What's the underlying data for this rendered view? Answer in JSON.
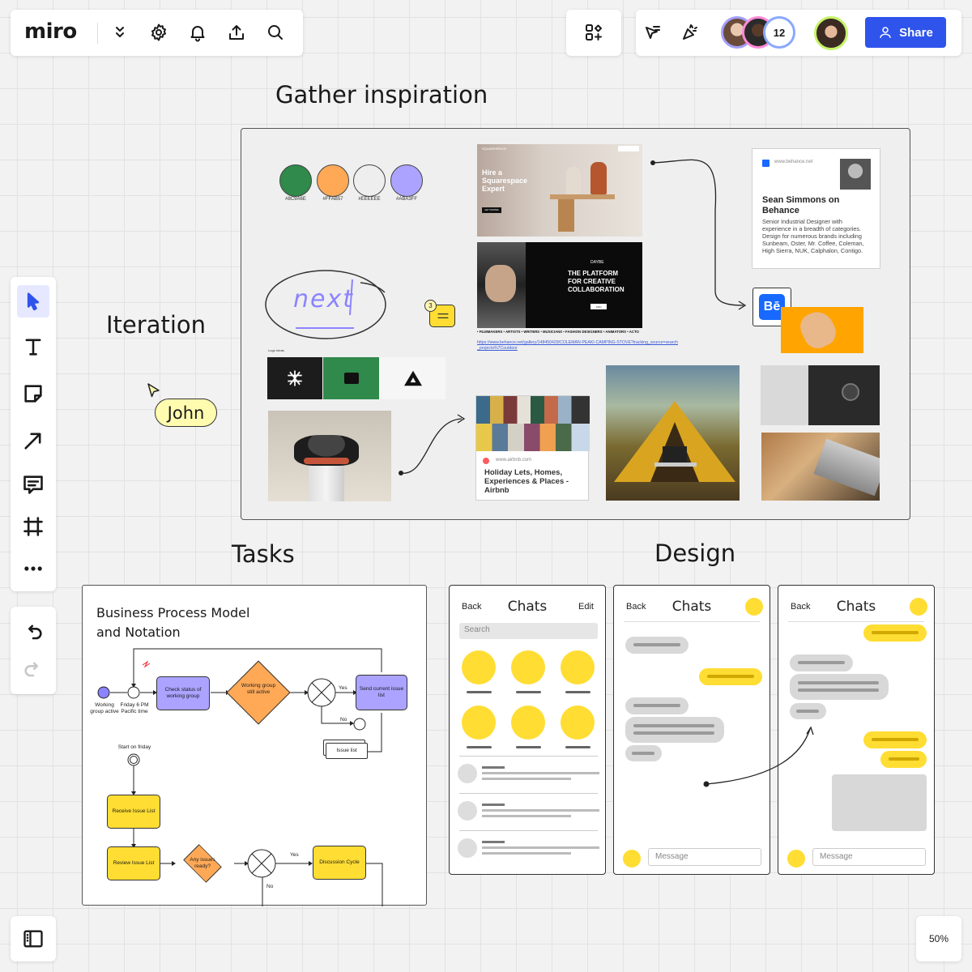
{
  "app": {
    "logo": "miro",
    "zoom": "50%"
  },
  "top_toolbar": {
    "icons": [
      "chevron-double-down-icon",
      "gear-icon",
      "bell-icon",
      "upload-icon",
      "search-icon"
    ]
  },
  "collab": {
    "user_count": "12",
    "share_label": "Share",
    "accent": "#2f54eb"
  },
  "sections": {
    "gather": "Gather inspiration",
    "iteration": "Iteration",
    "tasks": "Tasks",
    "design": "Design"
  },
  "cursor": {
    "name": "John"
  },
  "swatches": [
    {
      "color": "#2F8A4B",
      "label": "#8C9A6E"
    },
    {
      "color": "#FFA957",
      "label": "#FFAB57"
    },
    {
      "color": "#EEEEEE",
      "label": "#EEEEEE"
    },
    {
      "color": "#ABA3FF",
      "label": "#ABA3FF"
    }
  ],
  "sketch_word": "next",
  "comment_count": "3",
  "logo_strip_label": "Logo Ideas",
  "squarespace": {
    "brand": "SQUARESPACE",
    "headline_1": "Hire a",
    "headline_2": "Squarespace",
    "headline_3": "Expert",
    "btn": "GET STARTED"
  },
  "dribbble": {
    "brand": "DAYBE",
    "headline_1": "THE PLATFORM",
    "headline_2": "FOR CREATIVE",
    "headline_3": "COLLABORATION",
    "btn": "JOIN",
    "tags": "• FILMMAKERS • ARTISTS • WRITERS • MUSICIANS • FASHION DESIGNERS • ANIMATORS • ACTO"
  },
  "link_url": "https://www.behance.net/gallery/148450429/COLEMAN-PEAKI-CAMPING-STOVE?tracking_source=search_projects%7Coutdoor",
  "behance_card": {
    "site": "www.behance.net",
    "title": "Sean Simmons on Behance",
    "desc": "Senior Industrial Designer with experience in a breadth of categories. Design for numerous brands including Sunbeam, Oster, Mr. Coffee, Coleman, High Sierra, NUK, Calphalon, Contigo.",
    "badge": "Bē"
  },
  "airbnb_card": {
    "site": "www.airbnb.com",
    "title": "Holiday Lets, Homes, Experiences & Places - Airbnb"
  },
  "bpmn": {
    "title_1": "Business Process Model",
    "title_2": "and Notation",
    "nodes": {
      "start_label": "Working group active",
      "timer_label": "Friday 6 PM Pacific time",
      "check": "Check status of working group",
      "gateway": "Working group still active",
      "send": "Send current issue list",
      "yes_1": "Yes",
      "no_1": "No",
      "issue_list": "Issue list",
      "start_friday": "Start on friday",
      "receive": "Receive Issue List",
      "review": "Review Issue List",
      "any_issues": "Any issues ready?",
      "yes_2": "Yes",
      "no_2": "No",
      "discussion": "Discussion Cycle"
    }
  },
  "phones": [
    {
      "back": "Back",
      "title": "Chats",
      "edit": "Edit",
      "search": "Search"
    },
    {
      "back": "Back",
      "title": "Chats",
      "message": "Message"
    },
    {
      "back": "Back",
      "title": "Chats",
      "message": "Message"
    }
  ]
}
